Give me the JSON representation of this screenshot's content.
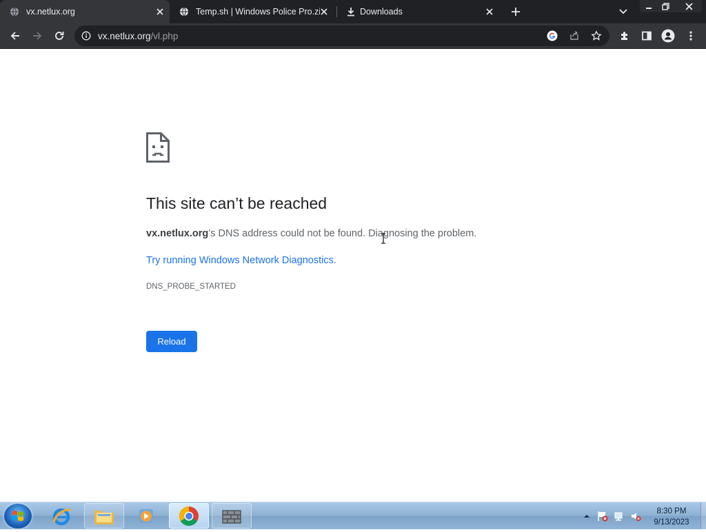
{
  "tabs": [
    {
      "title": "vx.netlux.org",
      "icon": "globe-grey-icon",
      "active": true
    },
    {
      "title": "Temp.sh | Windows Police Pro.zip",
      "icon": "globe-icon",
      "active": false
    },
    {
      "title": "Downloads",
      "icon": "download-icon",
      "active": false
    }
  ],
  "omnibox": {
    "host": "vx.netlux.org",
    "path": "/vl.php"
  },
  "error_page": {
    "title": "This site can’t be reached",
    "host": "vx.netlux.org",
    "message": "’s DNS address could not be found. Diagnosing the problem.",
    "suggestion_link": "Try running Windows Network Diagnostics",
    "suggestion_end": ".",
    "error_code": "DNS_PROBE_STARTED",
    "reload_label": "Reload"
  },
  "taskbar": {
    "items": [
      "internet-explorer-icon",
      "file-explorer-icon",
      "media-player-icon",
      "chrome-icon",
      "firewall-app-icon"
    ],
    "clock_time": "8:30 PM",
    "clock_date": "9/13/2023"
  },
  "colors": {
    "accent": "#1a73e8",
    "tabstrip": "#202124",
    "toolbar": "#35363a",
    "error_title": "#202124",
    "error_text": "#5f6368"
  }
}
